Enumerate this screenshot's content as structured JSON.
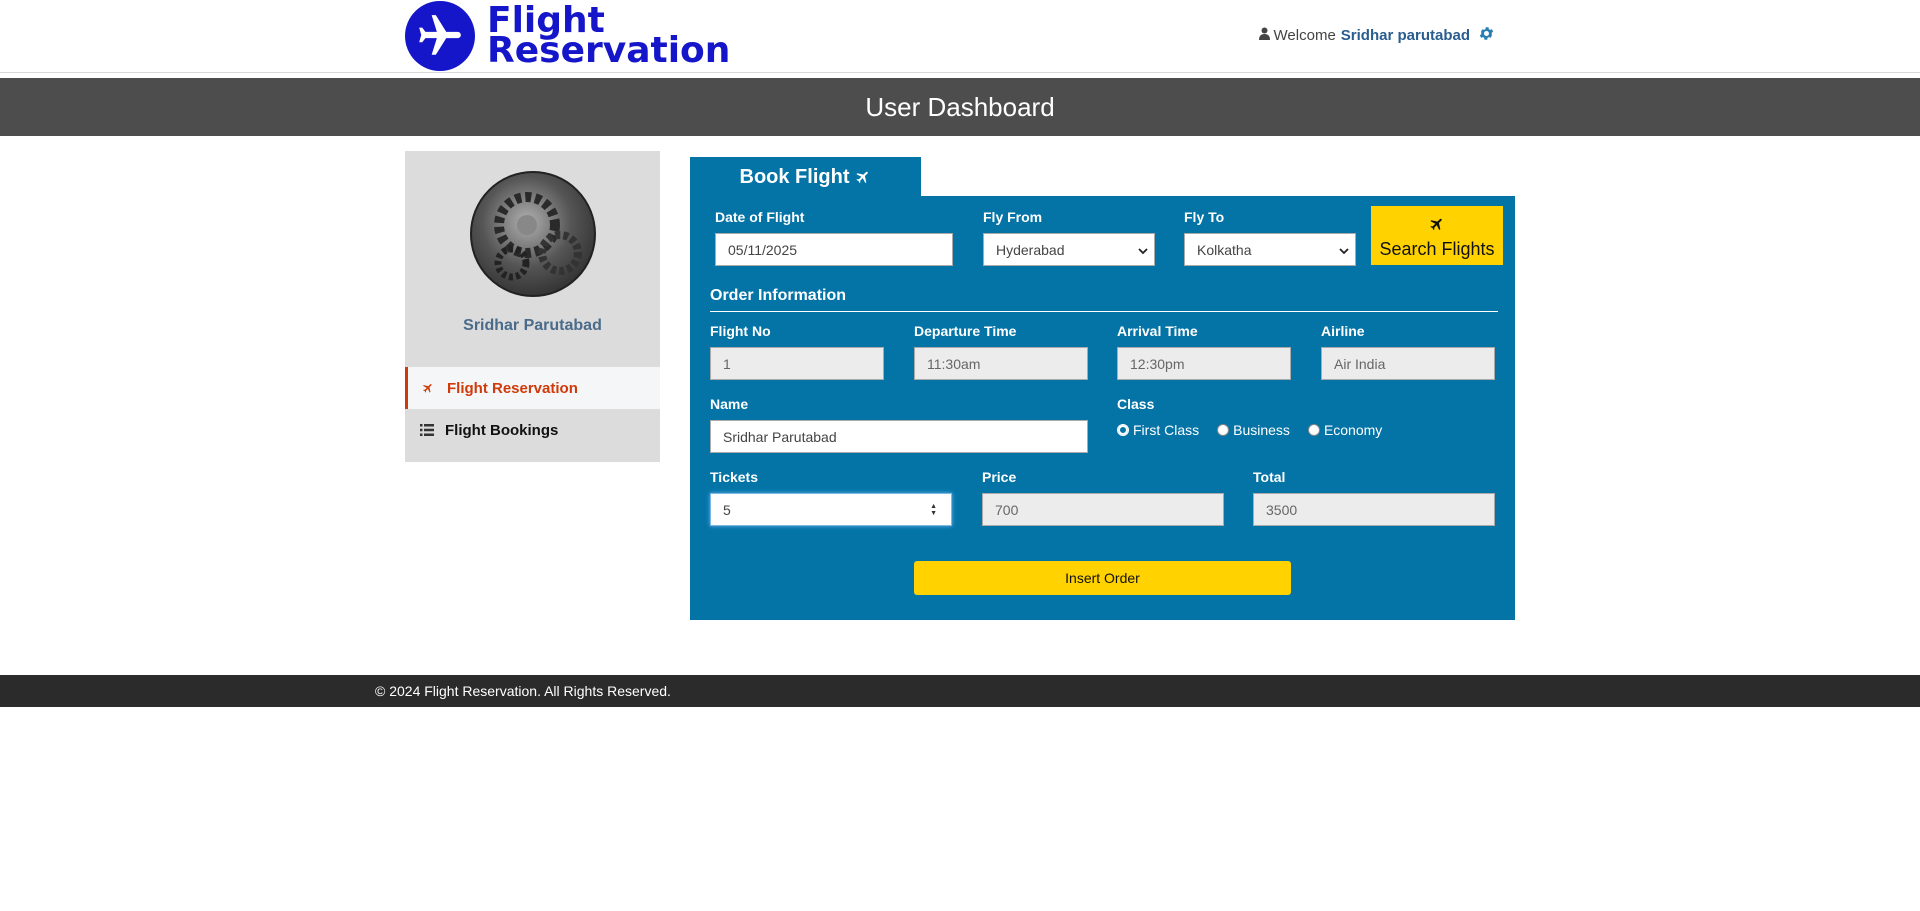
{
  "header": {
    "logo_line1": "Flight",
    "logo_line2": "Reservation",
    "welcome": "Welcome",
    "username": "Sridhar parutabad"
  },
  "title": "User Dashboard",
  "sidebar": {
    "profile_name": "Sridhar Parutabad",
    "items": [
      {
        "label": "Flight Reservation",
        "icon": "plane-icon",
        "active": true
      },
      {
        "label": "Flight Bookings",
        "icon": "list-icon",
        "active": false
      }
    ]
  },
  "panel": {
    "tab_label": "Book Flight",
    "date_label": "Date of Flight",
    "date_value": "05/11/2025",
    "from_label": "Fly From",
    "from_value": "Hyderabad",
    "to_label": "Fly To",
    "to_value": "Kolkatha",
    "search_label": "Search Flights",
    "section_title": "Order Information",
    "flight_no_label": "Flight No",
    "flight_no_value": "1",
    "departure_label": "Departure Time",
    "departure_value": "11:30am",
    "arrival_label": "Arrival Time",
    "arrival_value": "12:30pm",
    "airline_label": "Airline",
    "airline_value": "Air India",
    "name_label": "Name",
    "name_value": "Sridhar Parutabad",
    "class_label": "Class",
    "class_options": [
      "First Class",
      "Business",
      "Economy"
    ],
    "tickets_label": "Tickets",
    "tickets_value": "5",
    "price_label": "Price",
    "price_value": "700",
    "total_label": "Total",
    "total_value": "3500",
    "insert_label": "Insert Order"
  },
  "footer": {
    "text": "© 2024 Flight Reservation. All Rights Reserved."
  },
  "colors": {
    "brand": "#1515c9",
    "panel": "#0474a7",
    "accent": "#ffd200",
    "active": "#d03a0a"
  }
}
